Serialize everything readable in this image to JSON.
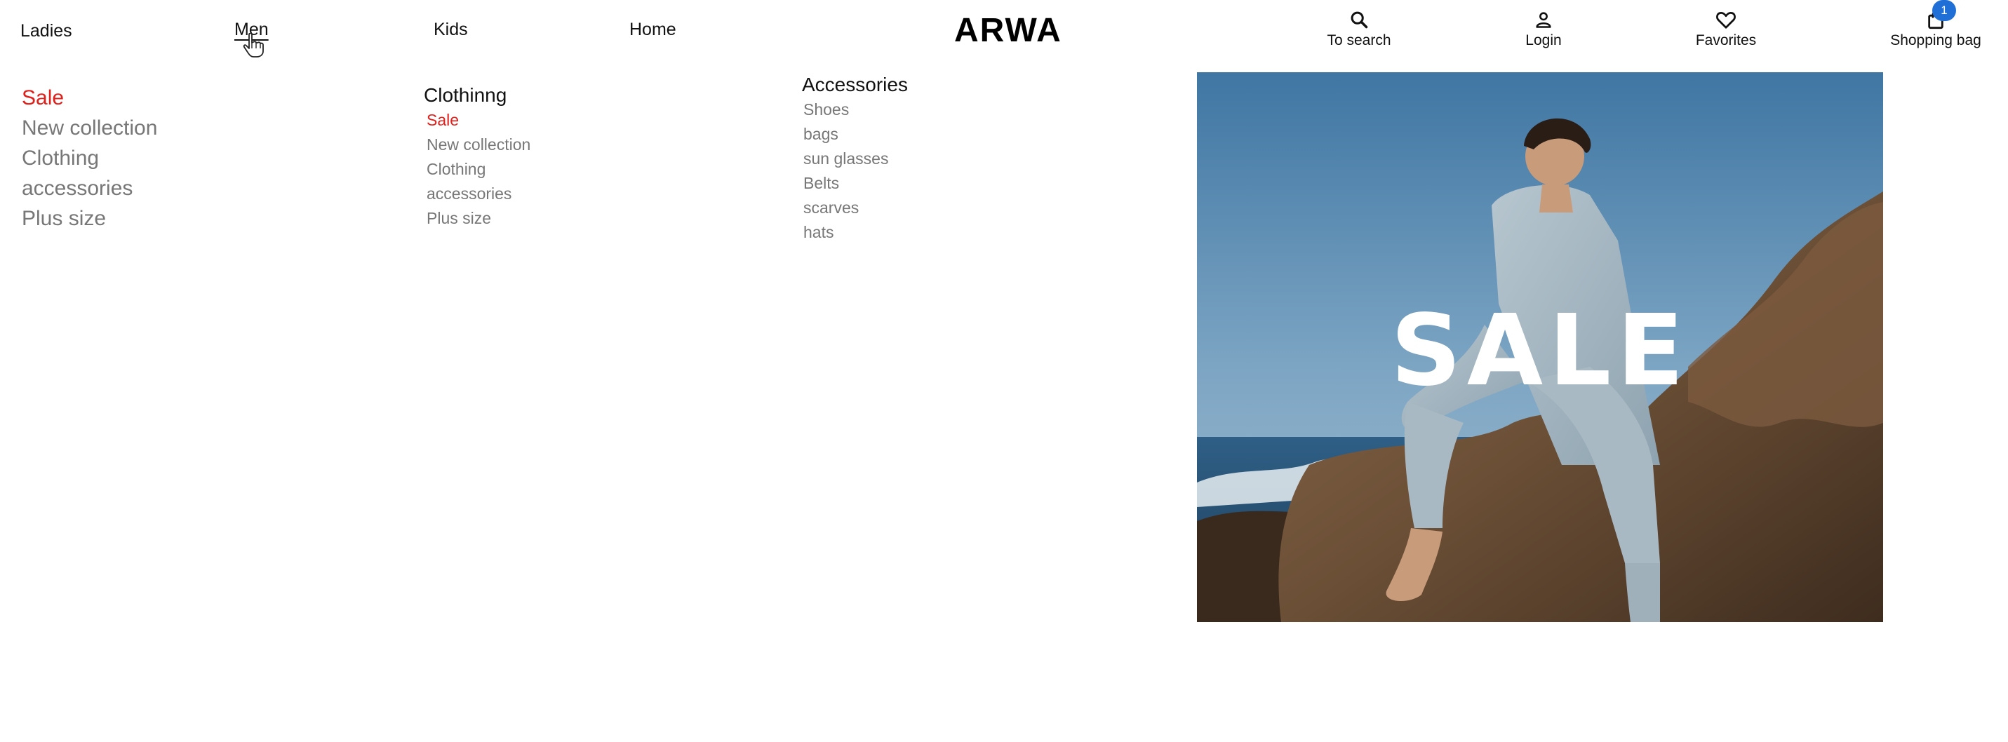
{
  "header": {
    "nav": [
      {
        "label": "Ladies"
      },
      {
        "label": "Men"
      },
      {
        "label": "Kids"
      },
      {
        "label": "Home"
      }
    ],
    "logo": "ARWA",
    "utilities": {
      "search": "To search",
      "login": "Login",
      "favorites": "Favorites",
      "bag": "Shopping bag",
      "bag_count": "1"
    }
  },
  "menu": {
    "column1": [
      "Sale",
      "New collection",
      "Clothing",
      "accessories",
      "Plus size"
    ],
    "clothing": {
      "heading": "Clothinng",
      "items": [
        "Sale",
        "New collection",
        "Clothing",
        "accessories",
        "Plus size"
      ]
    },
    "accessories": {
      "heading": "Accessories",
      "items": [
        "Shoes",
        "bags",
        "sun glasses",
        "Belts",
        "scarves",
        "hats"
      ]
    }
  },
  "banner": {
    "text": "SALE"
  },
  "colors": {
    "sale_red": "#e0201b",
    "badge_blue": "#1f6fd6",
    "muted_text": "#777777"
  }
}
